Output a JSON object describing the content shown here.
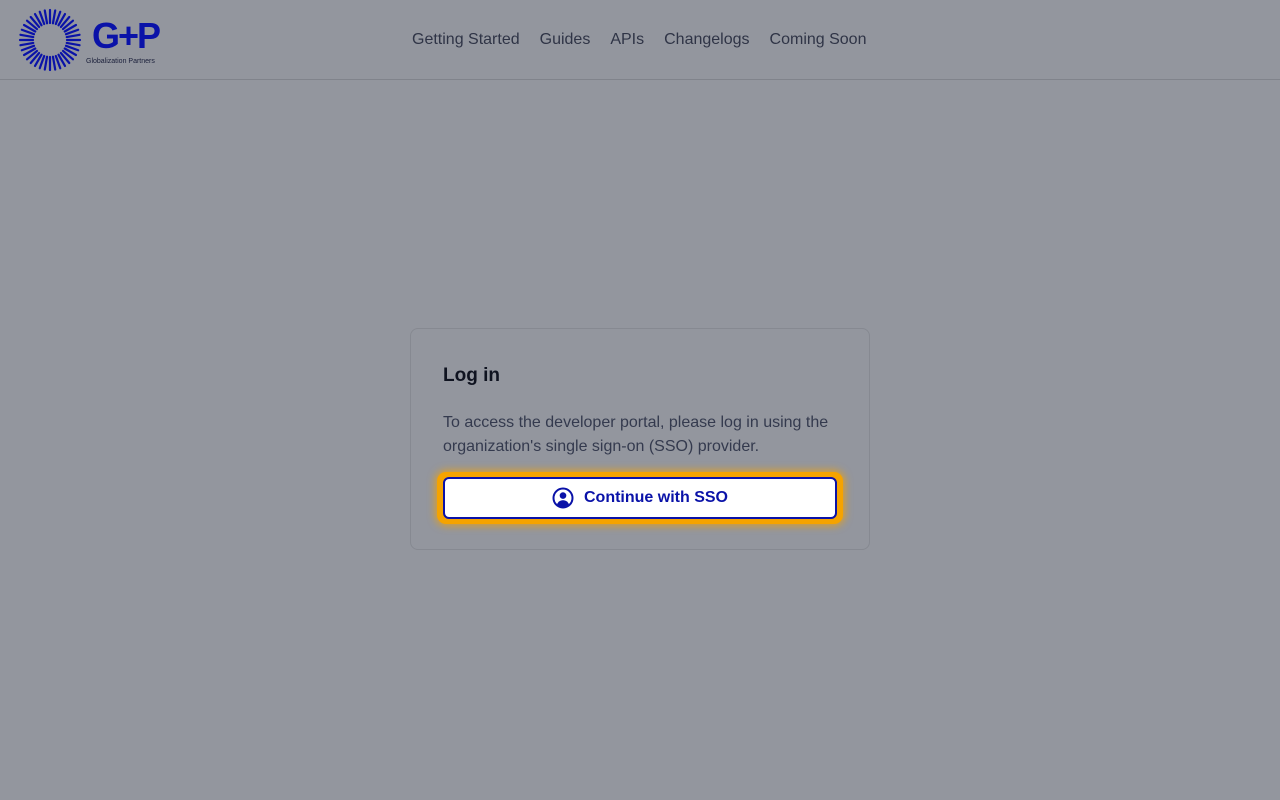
{
  "header": {
    "logo": {
      "mark": "G+P",
      "subtitle": "Globalization Partners",
      "icon": "sunburst-logo-icon",
      "brand_color": "#0a12a8"
    },
    "nav": [
      {
        "label": "Getting Started"
      },
      {
        "label": "Guides"
      },
      {
        "label": "APIs"
      },
      {
        "label": "Changelogs"
      },
      {
        "label": "Coming Soon"
      }
    ]
  },
  "login": {
    "title": "Log in",
    "description": "To access the developer portal, please log in using the organization's single sign-on (SSO) provider.",
    "sso_button": {
      "label": "Continue with SSO",
      "icon": "user-circle-icon",
      "focused": true
    }
  },
  "colors": {
    "background": "#93969e",
    "accent": "#0a12a8",
    "focus_ring": "#f5a300"
  }
}
